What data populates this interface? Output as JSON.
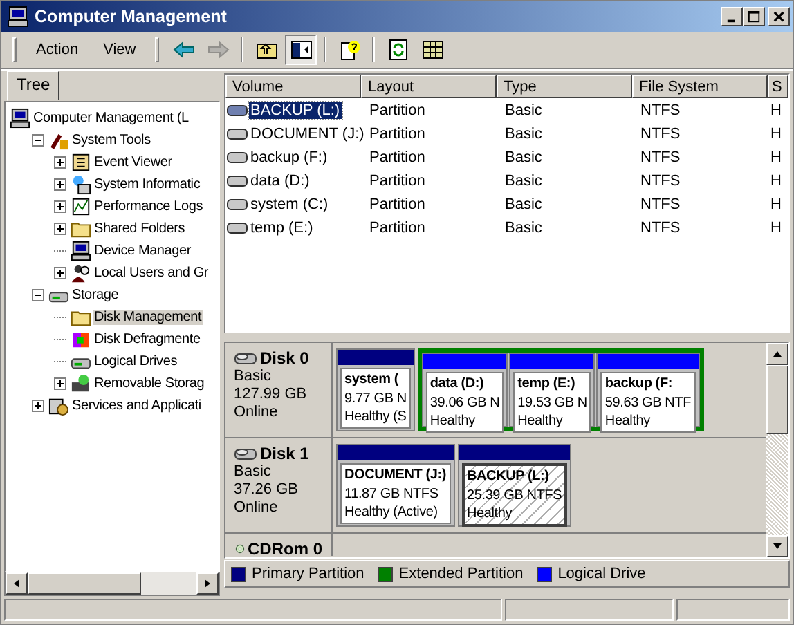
{
  "window": {
    "title": "Computer Management"
  },
  "menu": [
    "Action",
    "View"
  ],
  "toolbar": [
    {
      "kind": "back",
      "disabled": false
    },
    {
      "kind": "forward",
      "disabled": true
    },
    {
      "kind": "up",
      "disabled": false
    },
    {
      "kind": "tree",
      "disabled": false
    },
    {
      "kind": "help",
      "disabled": false
    },
    {
      "kind": "refresh",
      "disabled": false
    },
    {
      "kind": "export",
      "disabled": false
    }
  ],
  "tree_tab": {
    "label": "Tree",
    "selected": true
  },
  "tree": [
    {
      "label": "Computer Management (L",
      "selected": false,
      "children": [
        {
          "label": "System Tools",
          "kind": "node",
          "expanded": true,
          "selected": false,
          "children": [
            {
              "label": "Event Viewer",
              "kind": "node",
              "expanded": false,
              "selected": false
            },
            {
              "label": "System Informatic",
              "kind": "node",
              "expanded": false,
              "selected": false
            },
            {
              "label": "Performance Logs",
              "kind": "node",
              "expanded": false,
              "selected": false
            },
            {
              "label": "Shared Folders",
              "kind": "node",
              "expanded": false,
              "selected": false
            },
            {
              "label": "Device Manager",
              "kind": "leaf",
              "selected": false
            },
            {
              "label": "Local Users and Gr",
              "kind": "node",
              "expanded": false,
              "selected": false
            }
          ]
        },
        {
          "label": "Storage",
          "kind": "node",
          "expanded": true,
          "selected": false,
          "children": [
            {
              "label": "Disk Management",
              "kind": "leaf",
              "selected": true
            },
            {
              "label": "Disk Defragmente",
              "kind": "leaf",
              "selected": false
            },
            {
              "label": "Logical Drives",
              "kind": "leaf",
              "selected": false
            },
            {
              "label": "Removable Storag",
              "kind": "node",
              "expanded": false,
              "selected": false
            }
          ]
        },
        {
          "label": "Services and Applicati",
          "kind": "node",
          "expanded": false,
          "selected": false
        }
      ]
    }
  ],
  "table": {
    "columns": [
      "Volume",
      "Layout",
      "Type",
      "File System",
      "S"
    ],
    "rows": [
      {
        "cells": [
          "BACKUP (L:)",
          "Partition",
          "Basic",
          "NTFS",
          "H"
        ],
        "selected": true
      },
      {
        "cells": [
          "DOCUMENT (J:)",
          "Partition",
          "Basic",
          "NTFS",
          "H"
        ],
        "selected": false
      },
      {
        "cells": [
          "backup (F:)",
          "Partition",
          "Basic",
          "NTFS",
          "H"
        ],
        "selected": false
      },
      {
        "cells": [
          "data (D:)",
          "Partition",
          "Basic",
          "NTFS",
          "H"
        ],
        "selected": false
      },
      {
        "cells": [
          "system (C:)",
          "Partition",
          "Basic",
          "NTFS",
          "H"
        ],
        "selected": false
      },
      {
        "cells": [
          "temp (E:)",
          "Partition",
          "Basic",
          "NTFS",
          "H"
        ],
        "selected": false
      }
    ]
  },
  "disks": [
    {
      "name": "Disk 0",
      "type": "Basic",
      "size": "127.99 GB",
      "status": "Online",
      "regions": [
        {
          "kind": "primary",
          "name": "system (",
          "size": "9.77 GB N",
          "health": "Healthy (S",
          "selected": false
        },
        {
          "kind": "extended",
          "partitions": [
            {
              "kind": "logical",
              "name": "data  (D:)",
              "size": "39.06 GB N",
              "health": "Healthy",
              "selected": false
            },
            {
              "kind": "logical",
              "name": "temp  (E:)",
              "size": "19.53 GB N",
              "health": "Healthy",
              "selected": false
            },
            {
              "kind": "logical",
              "name": "backup  (F:",
              "size": "59.63 GB NTF",
              "health": "Healthy",
              "selected": false
            }
          ]
        }
      ]
    },
    {
      "name": "Disk 1",
      "type": "Basic",
      "size": "37.26 GB",
      "status": "Online",
      "regions": [
        {
          "kind": "primary",
          "name": "DOCUMENT  (J:)",
          "size": "11.87 GB NTFS",
          "health": "Healthy (Active)",
          "selected": false
        },
        {
          "kind": "primary",
          "name": "BACKUP  (L:)",
          "size": "25.39 GB NTFS",
          "health": "Healthy",
          "selected": true
        }
      ]
    },
    {
      "name": "CDRom 0",
      "kind": "cdrom"
    }
  ],
  "legend": [
    {
      "label": "Primary Partition",
      "color": "#000080"
    },
    {
      "label": "Extended Partition",
      "color": "#008000"
    },
    {
      "label": "Logical Drive",
      "color": "#0000ff"
    }
  ]
}
